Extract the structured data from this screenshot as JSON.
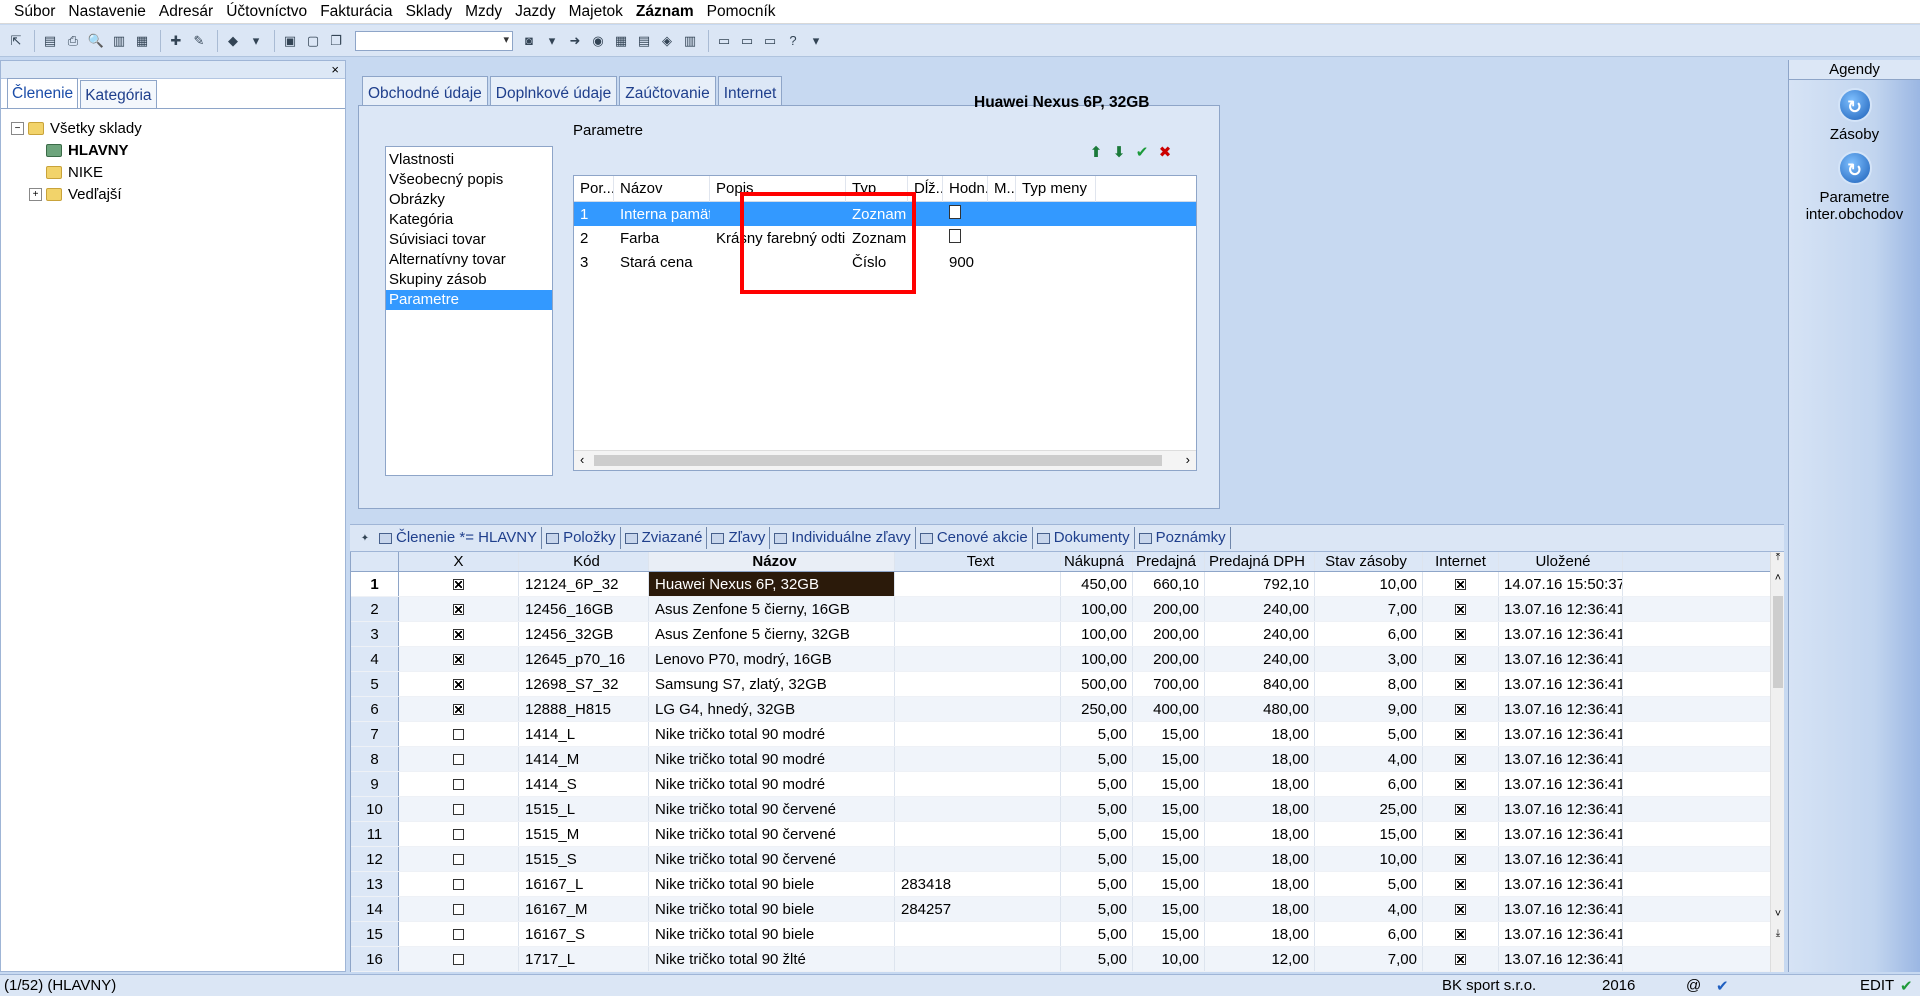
{
  "menu": [
    "Súbor",
    "Nastavenie",
    "Adresár",
    "Účtovníctvo",
    "Fakturácia",
    "Sklady",
    "Mzdy",
    "Jazdy",
    "Majetok",
    "Záznam",
    "Pomocník"
  ],
  "menu_bold_index": 9,
  "left_panel": {
    "close": "×",
    "tabs": [
      "Členenie",
      "Kategória"
    ],
    "tree": [
      {
        "label": "Všetky sklady",
        "expander": "−",
        "icon": "folder-icon"
      },
      {
        "label": "HLAVNY",
        "selected": true,
        "icon": "warehouse-icon"
      },
      {
        "label": "NIKE",
        "icon": "folder-icon"
      },
      {
        "label": "Vedľajší",
        "expander": "+",
        "icon": "folder-icon"
      }
    ]
  },
  "form": {
    "tabs": [
      "Obchodné údaje",
      "Doplnkové údaje",
      "Zaúčtovanie",
      "Internet"
    ],
    "active_tab": 3,
    "product_title": "Huawei Nexus 6P, 32GB",
    "properties": [
      "Vlastnosti",
      "Všeobecný popis",
      "Obrázky",
      "Kategória",
      "Súvisiaci tovar",
      "Alternatívny tovar",
      "Skupiny zásob",
      "Parametre"
    ],
    "properties_selected": 7,
    "param_label": "Parametre",
    "param_icons": [
      "arrow-up-icon",
      "arrow-down-icon",
      "check-icon",
      "delete-icon"
    ],
    "param_columns": [
      "Por...",
      "Názov",
      "Popis",
      "Typ",
      "Dĺž...",
      "Hodn...",
      "M...",
      "Typ meny"
    ],
    "param_rows": [
      {
        "por": "1",
        "nazov": "Interna pamäť",
        "popis": "",
        "typ": "Zoznam",
        "hodnota_icon": true,
        "hodnota": ""
      },
      {
        "por": "2",
        "nazov": "Farba",
        "popis": "Krásny farebný odtieň",
        "typ": "Zoznam",
        "hodnota_icon": true,
        "hodnota": ""
      },
      {
        "por": "3",
        "nazov": "Stará cena",
        "popis": "",
        "typ": "Číslo",
        "hodnota_icon": false,
        "hodnota": "900"
      }
    ]
  },
  "bottom_tabs": [
    "Členenie *= HLAVNY",
    "Položky",
    "Zviazané",
    "Zľavy",
    "Individuálne zľavy",
    "Cenové akcie",
    "Dokumenty",
    "Poznámky"
  ],
  "grid": {
    "columns": [
      "X",
      "Kód",
      "Názov",
      "Text",
      "Nákupná",
      "Predajná",
      "Predajná DPH",
      "Stav zásoby",
      "Internet",
      "Uložené"
    ],
    "rows": [
      {
        "n": "1",
        "x": true,
        "kod": "12124_6P_32",
        "nazov": "Huawei Nexus 6P, 32GB",
        "text": "",
        "nakupna": "450,00",
        "predajna": "660,10",
        "dph": "792,10",
        "stav": "10,00",
        "internet": true,
        "ulozene": "14.07.16 15:50:37"
      },
      {
        "n": "2",
        "x": true,
        "kod": "12456_16GB",
        "nazov": "Asus Zenfone 5 čierny, 16GB",
        "text": "",
        "nakupna": "100,00",
        "predajna": "200,00",
        "dph": "240,00",
        "stav": "7,00",
        "internet": true,
        "ulozene": "13.07.16 12:36:41"
      },
      {
        "n": "3",
        "x": true,
        "kod": "12456_32GB",
        "nazov": "Asus Zenfone 5 čierny, 32GB",
        "text": "",
        "nakupna": "100,00",
        "predajna": "200,00",
        "dph": "240,00",
        "stav": "6,00",
        "internet": true,
        "ulozene": "13.07.16 12:36:41"
      },
      {
        "n": "4",
        "x": true,
        "kod": "12645_p70_16",
        "nazov": "Lenovo P70, modrý, 16GB",
        "text": "",
        "nakupna": "100,00",
        "predajna": "200,00",
        "dph": "240,00",
        "stav": "3,00",
        "internet": true,
        "ulozene": "13.07.16 12:36:41"
      },
      {
        "n": "5",
        "x": true,
        "kod": "12698_S7_32",
        "nazov": "Samsung S7, zlatý, 32GB",
        "text": "",
        "nakupna": "500,00",
        "predajna": "700,00",
        "dph": "840,00",
        "stav": "8,00",
        "internet": true,
        "ulozene": "13.07.16 12:36:41"
      },
      {
        "n": "6",
        "x": true,
        "kod": "12888_H815",
        "nazov": "LG G4, hnedý, 32GB",
        "text": "",
        "nakupna": "250,00",
        "predajna": "400,00",
        "dph": "480,00",
        "stav": "9,00",
        "internet": true,
        "ulozene": "13.07.16 12:36:41"
      },
      {
        "n": "7",
        "x": false,
        "kod": "1414_L",
        "nazov": "Nike tričko total 90 modré",
        "text": "",
        "nakupna": "5,00",
        "predajna": "15,00",
        "dph": "18,00",
        "stav": "5,00",
        "internet": true,
        "ulozene": "13.07.16 12:36:41"
      },
      {
        "n": "8",
        "x": false,
        "kod": "1414_M",
        "nazov": "Nike tričko total 90 modré",
        "text": "",
        "nakupna": "5,00",
        "predajna": "15,00",
        "dph": "18,00",
        "stav": "4,00",
        "internet": true,
        "ulozene": "13.07.16 12:36:41"
      },
      {
        "n": "9",
        "x": false,
        "kod": "1414_S",
        "nazov": "Nike tričko total 90 modré",
        "text": "",
        "nakupna": "5,00",
        "predajna": "15,00",
        "dph": "18,00",
        "stav": "6,00",
        "internet": true,
        "ulozene": "13.07.16 12:36:41"
      },
      {
        "n": "10",
        "x": false,
        "kod": "1515_L",
        "nazov": "Nike tričko total 90 červené",
        "text": "",
        "nakupna": "5,00",
        "predajna": "15,00",
        "dph": "18,00",
        "stav": "25,00",
        "internet": true,
        "ulozene": "13.07.16 12:36:41"
      },
      {
        "n": "11",
        "x": false,
        "kod": "1515_M",
        "nazov": "Nike tričko total 90 červené",
        "text": "",
        "nakupna": "5,00",
        "predajna": "15,00",
        "dph": "18,00",
        "stav": "15,00",
        "internet": true,
        "ulozene": "13.07.16 12:36:41"
      },
      {
        "n": "12",
        "x": false,
        "kod": "1515_S",
        "nazov": "Nike tričko total 90 červené",
        "text": "",
        "nakupna": "5,00",
        "predajna": "15,00",
        "dph": "18,00",
        "stav": "10,00",
        "internet": true,
        "ulozene": "13.07.16 12:36:41"
      },
      {
        "n": "13",
        "x": false,
        "kod": "16167_L",
        "nazov": "Nike tričko total 90 biele",
        "text": "283418",
        "nakupna": "5,00",
        "predajna": "15,00",
        "dph": "18,00",
        "stav": "5,00",
        "internet": true,
        "ulozene": "13.07.16 12:36:41"
      },
      {
        "n": "14",
        "x": false,
        "kod": "16167_M",
        "nazov": "Nike tričko total 90 biele",
        "text": "284257",
        "nakupna": "5,00",
        "predajna": "15,00",
        "dph": "18,00",
        "stav": "4,00",
        "internet": true,
        "ulozene": "13.07.16 12:36:41"
      },
      {
        "n": "15",
        "x": false,
        "kod": "16167_S",
        "nazov": "Nike tričko total 90 biele",
        "text": "",
        "nakupna": "5,00",
        "predajna": "15,00",
        "dph": "18,00",
        "stav": "6,00",
        "internet": true,
        "ulozene": "13.07.16 12:36:41"
      },
      {
        "n": "16",
        "x": false,
        "kod": "1717_L",
        "nazov": "Nike tričko total 90 žlté",
        "text": "",
        "nakupna": "5,00",
        "predajna": "10,00",
        "dph": "12,00",
        "stav": "7,00",
        "internet": true,
        "ulozene": "13.07.16 12:36:41"
      }
    ]
  },
  "agendy": {
    "title": "Agendy",
    "items": [
      {
        "label": "Zásoby"
      },
      {
        "label": "Parametre inter.obchodov"
      }
    ]
  },
  "status": {
    "left": "(1/52) (HLAVNY)",
    "company": "BK sport  s.r.o.",
    "year": "2016",
    "at": "@",
    "mode": "EDIT"
  },
  "colors": {
    "selection": "#3399ff",
    "highlight_box": "#ff0000",
    "panel_bg": "#dce7f6"
  }
}
